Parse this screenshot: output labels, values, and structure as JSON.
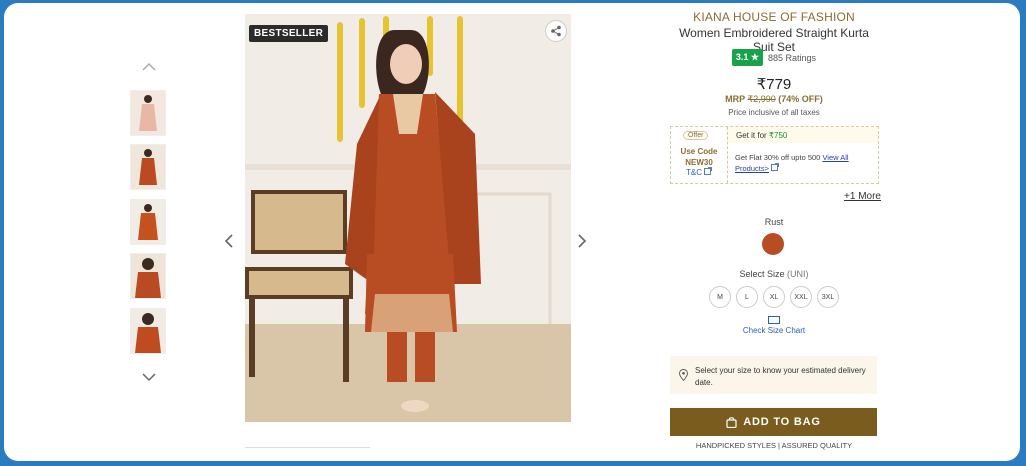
{
  "gallery": {
    "badge": "BESTSELLER",
    "prev_thumb_icon": "chevron-up-icon",
    "next_thumb_icon": "chevron-down-icon",
    "prev_image_icon": "chevron-left-icon",
    "next_image_icon": "chevron-right-icon",
    "share_icon": "share-icon"
  },
  "product": {
    "brand": "KIANA HOUSE OF FASHION",
    "name": "Women Embroidered Straight Kurta Suit Set",
    "rating": "3.1 ★",
    "ratings_count": "885 Ratings",
    "price": "₹779",
    "mrp_label": "MRP",
    "mrp": "₹2,990",
    "discount": "(74% OFF)",
    "tax_note": "Price inclusive of all taxes"
  },
  "offer": {
    "tag": "Offer",
    "use_code_label": "Use Code",
    "code": "NEW30",
    "tnc": "T&C",
    "get_it_label": "Get it for",
    "get_it_price": "₹750",
    "desc": "Get Flat 30% off upto 500",
    "link": "View All Products>",
    "more": "+1 More"
  },
  "color": {
    "label": "Rust",
    "value": "#b84d24"
  },
  "size": {
    "label": "Select Size",
    "unit": "(UNI)",
    "options": [
      "M",
      "L",
      "XL",
      "XXL",
      "3XL"
    ],
    "chart_link": "Check Size Chart"
  },
  "delivery": {
    "text": "Select your size to know your estimated delivery date."
  },
  "cta": {
    "add_to_bag": "ADD TO BAG",
    "assurance": "HANDPICKED STYLES | ASSURED QUALITY"
  }
}
